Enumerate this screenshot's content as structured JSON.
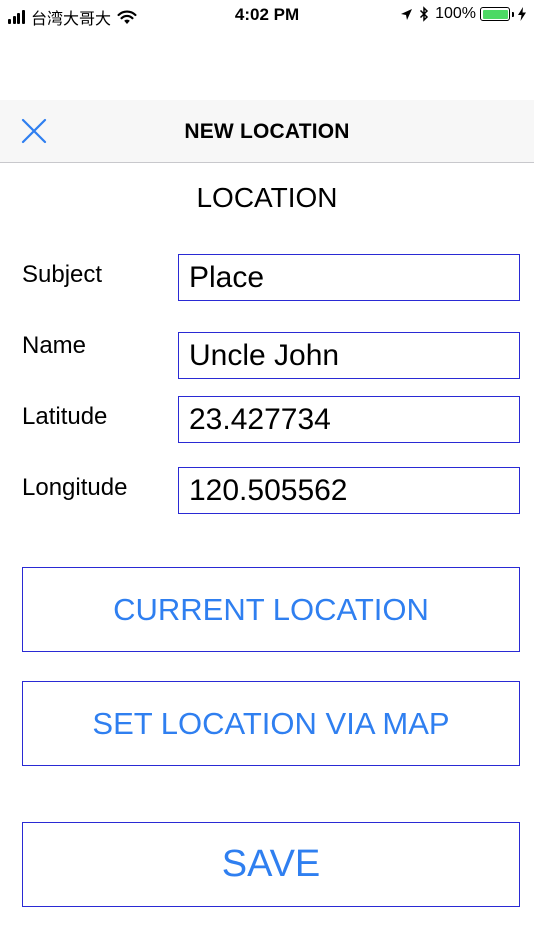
{
  "status_bar": {
    "carrier": "台湾大哥大",
    "time": "4:02 PM",
    "battery_percent": "100%",
    "battery_color": "#4cd964"
  },
  "nav": {
    "title": "NEW LOCATION",
    "close_icon": "close-icon"
  },
  "form": {
    "section_title": "LOCATION",
    "fields": [
      {
        "label": "Subject",
        "value": "Place"
      },
      {
        "label": "Name",
        "value": "Uncle John"
      },
      {
        "label": "Latitude",
        "value": "23.427734"
      },
      {
        "label": "Longitude",
        "value": "120.505562"
      }
    ]
  },
  "actions": {
    "current_location": "CURRENT LOCATION",
    "set_via_map": "SET LOCATION VIA MAP",
    "save": "SAVE"
  },
  "colors": {
    "accent_text": "#2f7ff0",
    "border": "#2a2ad4"
  }
}
